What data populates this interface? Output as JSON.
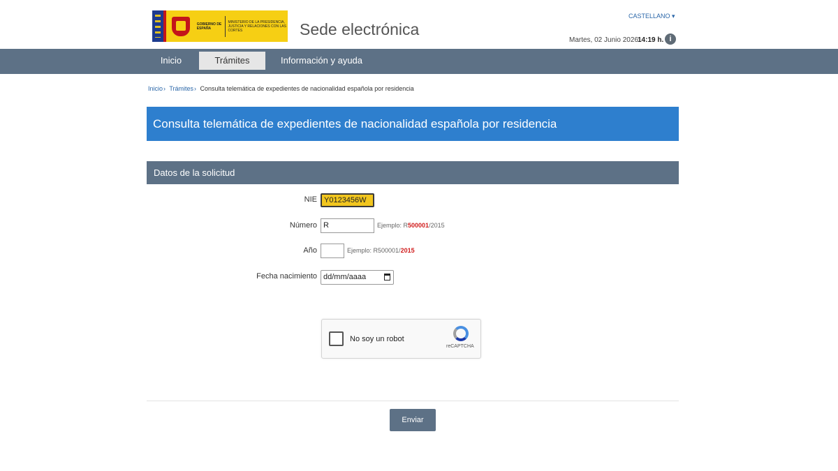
{
  "header": {
    "logo_gov": "GOBIERNO DE ESPAÑA",
    "logo_ministry": "MINISTERIO DE LA PRESIDENCIA, JUSTICIA Y RELACIONES CON LAS CORTES",
    "site_title": "Sede electrónica",
    "language": "CASTELLANO ▾",
    "date": "Martes, 02 Junio 2026",
    "time": "14:19 h.",
    "info_icon": "i"
  },
  "nav": {
    "items": [
      {
        "label": "Inicio"
      },
      {
        "label": "Trámites"
      },
      {
        "label": "Información y ayuda"
      }
    ]
  },
  "breadcrumb": {
    "items": [
      "Inicio",
      "Trámites"
    ],
    "current": "Consulta telemática de expedientes de nacionalidad española por residencia"
  },
  "page": {
    "title": "Consulta telemática de expedientes de nacionalidad española por residencia",
    "section_title": "Datos de la solicitud"
  },
  "form": {
    "nie_label": "NIE",
    "nie_value": "Y0123456W",
    "numero_label": "Número",
    "numero_value": "R",
    "numero_hint_prefix": "Ejemplo: R",
    "numero_hint_bold": "500001",
    "numero_hint_suffix": "/2015",
    "ano_label": "Año",
    "ano_hint_prefix": "Ejemplo: R500001/",
    "ano_hint_bold": "2015",
    "fecha_label": "Fecha nacimiento",
    "fecha_value": "dd/mm/aaaa"
  },
  "captcha": {
    "label": "No soy un robot",
    "brand": "reCAPTCHA"
  },
  "actions": {
    "submit_label": "Enviar"
  },
  "colors": {
    "nav_bg": "#5d7186",
    "banner_bg": "#2e7fce",
    "nie_highlight": "#f2c61e",
    "hint_red": "#d01c1c"
  }
}
